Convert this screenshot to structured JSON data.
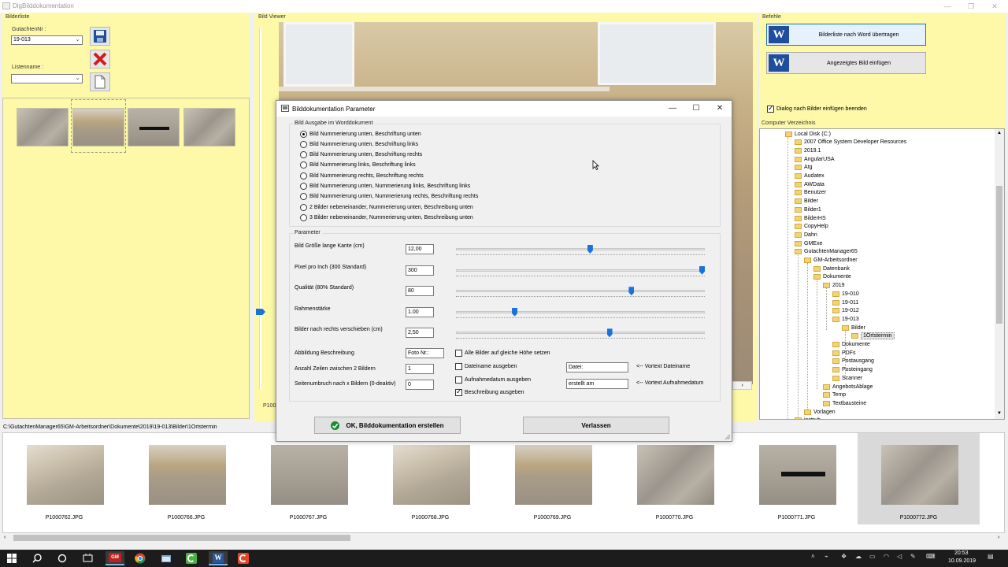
{
  "window": {
    "title": "DlgBilddokumentation",
    "controls": [
      "—",
      "❐",
      "✕"
    ]
  },
  "bilderliste": {
    "title": "Bilderliste",
    "gutachten_label": "GutachtenNr :",
    "gutachten_value": "19-013",
    "listenname_label": "Listenname :",
    "listenname_value": ""
  },
  "viewer": {
    "title": "Bild Viewer",
    "bottom_text": "P100"
  },
  "befehle": {
    "title": "Befehle",
    "btn1": "Bilderliste nach Word übertragen",
    "btn2": "Angezeigtes Bild einfügen",
    "word_icon": "W",
    "dialog_check": "Dialog nach Bilder einfügen beenden"
  },
  "verzeichnis": {
    "title": "Computer Verzeichnis",
    "items": [
      "Local Disk (C:)",
      "2007 Office System Developer Resources",
      "2019.1",
      "AngularUSA",
      "Atg",
      "Audatex",
      "AWData",
      "Benutzer",
      "Bilder",
      "Bilder1",
      "BilderHS",
      "CopyHelp",
      "Dahn",
      "GMExe",
      "GutachtenManager65",
      "GM-Arbeitsordner",
      "Datenbank",
      "Dokumente",
      "2019",
      "19-010",
      "19-011",
      "19-012",
      "19-013",
      "Bilder",
      "1Ortstermin",
      "Dokumente",
      "PDFs",
      "Postausgang",
      "Posteingang",
      "Scanner",
      "AngebotsAblage",
      "Temp",
      "Textbausteine",
      "Vorlagen",
      "instruh"
    ]
  },
  "dialog": {
    "title": "Bilddokumentation Parameter",
    "group1": "Bild Ausgabe im Worddokument",
    "options": [
      "Bild Nummerierung unten, Beschriftung unten",
      "Bild Nummerierung unten, Beschriftung links",
      "Bild Nummerierung unten, Beschriftung rechts",
      "Bild Nummerierung links, Beschriftung links",
      "Bild Nummerierung rechts, Beschriftung rechts",
      "Bild Nummerierung unten, Nummerierung links, Beschriftung links",
      "Bild Nummerierung unten, Nummerierung rechts, Beschriftung rechts",
      "2 Bilder nebeneinander, Nummerierung unten, Beschreibung unten",
      "3 Bilder nebeneinander, Nummerierung unten, Beschreibung unten"
    ],
    "selected_option": 0,
    "group2": "Parameter",
    "params": [
      {
        "label": "Bild Größe lange Kante (cm)",
        "value": "12,00",
        "level": 0.54
      },
      {
        "label": "Pixel pro Inch (300 Standard)",
        "value": "300",
        "level": 1.0
      },
      {
        "label": "Qualität  (80% Standard)",
        "value": "80",
        "level": 0.71
      },
      {
        "label": "Rahmenstärke",
        "value": "1.00",
        "level": 0.23
      },
      {
        "label": "Bilder nach rechts verschieben (cm)",
        "value": "2,50",
        "level": 0.62
      }
    ],
    "abbildung_label": "Abbildung Beschreibung",
    "abbildung_value": "Foto Nr.:",
    "zeilen_label": "Anzahl Zeilen zwischen 2 Bildern",
    "zeilen_value": "1",
    "seitenumbruch_label": "Seitenumbruch nach x Bildern (0-deaktiv)",
    "seitenumbruch_value": "0",
    "chk_hoehe": "Alle Bilder auf gleiche Höhe setzen",
    "chk_dateiname": "Dateiname ausgeben",
    "chk_aufnahme": "Aufnahmedatum ausgeben",
    "chk_beschreibung": "Beschreibung ausgeben",
    "vortext_datei_value": "Datei:",
    "vortext_datei_label": "<-- Vortext Dateiname",
    "vortext_aufnahme_value": "erstellt am",
    "vortext_aufnahme_label": "<-- Vortext Aufnahmedatum",
    "ok_button": "OK, Bilddokumentation erstellen",
    "leave_button": "Verlassen"
  },
  "path": "C:\\GutachtenManager65\\GM-Arbeitsordner\\Dokumente\\2019\\19-013\\Bilder\\1Ortstermin",
  "strip": [
    "P1000762.JPG",
    "P1000766.JPG",
    "P1000767.JPG",
    "P1000768.JPG",
    "P1000769.JPG",
    "P1000770.JPG",
    "P1000771.JPG",
    "P1000772.JPG"
  ],
  "taskbar": {
    "time": "20:53",
    "date": "10.09.2019",
    "gm_label": "GM"
  }
}
